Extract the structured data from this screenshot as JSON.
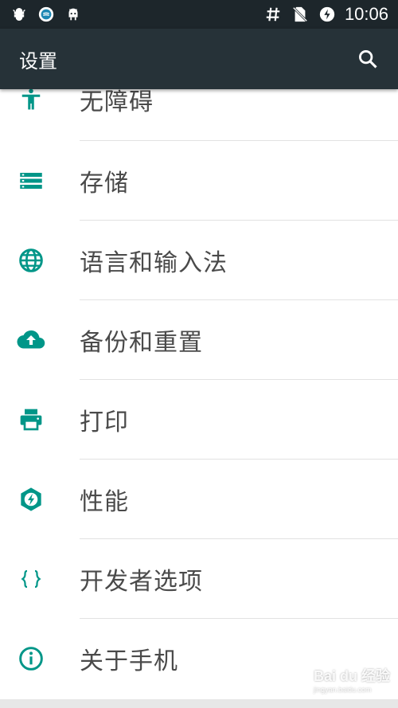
{
  "status_bar": {
    "time": "10:06",
    "left_icons": [
      "bug-icon",
      "app-notification-icon",
      "android-debug-icon"
    ],
    "right_icons": [
      "hash-icon",
      "no-sim-icon",
      "battery-charging-icon"
    ]
  },
  "app_bar": {
    "title": "设置",
    "search_icon": "search-icon",
    "background": "#263238"
  },
  "settings_items": [
    {
      "label": "无障碍",
      "icon": "accessibility-icon"
    },
    {
      "label": "存储",
      "icon": "storage-icon"
    },
    {
      "label": "语言和输入法",
      "icon": "language-icon"
    },
    {
      "label": "备份和重置",
      "icon": "cloud-backup-icon"
    },
    {
      "label": "打印",
      "icon": "print-icon"
    },
    {
      "label": "性能",
      "icon": "performance-icon"
    },
    {
      "label": "开发者选项",
      "icon": "developer-options-icon"
    },
    {
      "label": "关于手机",
      "icon": "about-phone-icon"
    }
  ],
  "accent_color": "#009688",
  "watermark": {
    "brand": "Bai du 经验",
    "url": "jingyan.baidu.com"
  }
}
